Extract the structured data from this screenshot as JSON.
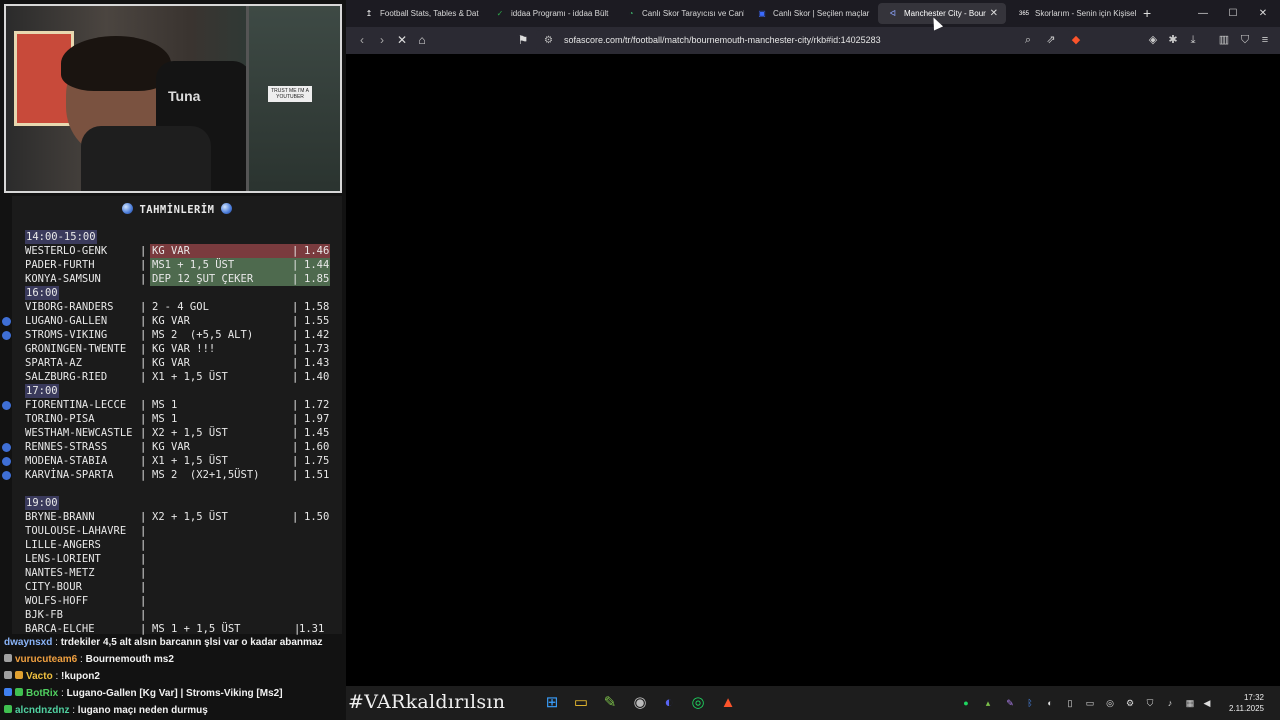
{
  "overlay": {
    "title": "TAHMİNLERİM",
    "rows": [
      {
        "type": "time",
        "label": "14:00-15:00"
      },
      {
        "type": "bet",
        "match": "WESTERLO-GENK",
        "bet": "KG VAR",
        "odds": "1.46",
        "hl": "red"
      },
      {
        "type": "bet",
        "match": "PADER-FURTH",
        "bet": "MS1 + 1,5 ÜST",
        "odds": "1.44",
        "hl": "green"
      },
      {
        "type": "bet",
        "match": "KONYA-SAMSUN",
        "bet": "DEP 12 ŞUT ÇEKER",
        "odds": "1.85",
        "hl": "green"
      },
      {
        "type": "time",
        "label": "16:00"
      },
      {
        "type": "bet",
        "match": "VIBORG-RANDERS",
        "bet": "2 - 4 GOL",
        "odds": "1.58"
      },
      {
        "type": "bet",
        "match": "LUGANO-GALLEN",
        "bet": "KG VAR",
        "odds": "1.55",
        "bullet": true
      },
      {
        "type": "bet",
        "match": "STROMS-VIKING",
        "bet": "MS 2  (+5,5 ALT)",
        "odds": "1.42",
        "bullet": true
      },
      {
        "type": "bet",
        "match": "GRONINGEN-TWENTE",
        "bet": "KG VAR !!!",
        "odds": "1.73"
      },
      {
        "type": "bet",
        "match": "SPARTA-AZ",
        "bet": "KG VAR",
        "odds": "1.43"
      },
      {
        "type": "bet",
        "match": "SALZBURG-RIED",
        "bet": "X1 + 1,5 ÜST",
        "odds": "1.40"
      },
      {
        "type": "time",
        "label": "17:00"
      },
      {
        "type": "bet",
        "match": "FIORENTINA-LECCE",
        "bet": "MS 1",
        "odds": "1.72",
        "bullet": true
      },
      {
        "type": "bet",
        "match": "TORINO-PISA",
        "bet": "MS 1",
        "odds": "1.97"
      },
      {
        "type": "bet",
        "match": "WESTHAM-NEWCASTLE",
        "bet": "X2 + 1,5 ÜST",
        "odds": "1.45"
      },
      {
        "type": "bet",
        "match": "RENNES-STRASS",
        "bet": "KG VAR",
        "odds": "1.60",
        "bullet": true
      },
      {
        "type": "bet",
        "match": "MODENA-STABIA",
        "bet": "X1 + 1,5 ÜST",
        "odds": "1.75",
        "bullet": true
      },
      {
        "type": "bet",
        "match": "KARVİNA-SPARTA",
        "bet": "MS 2  (X2+1,5ÜST)",
        "odds": "1.51",
        "bullet": true
      },
      {
        "type": "blank"
      },
      {
        "type": "time",
        "label": "19:00"
      },
      {
        "type": "bet",
        "match": "BRYNE-BRANN",
        "bet": "X2 + 1,5 ÜST",
        "odds": "1.50"
      },
      {
        "type": "bet",
        "match": "TOULOUSE-LAHAVRE",
        "bet": "",
        "odds": ""
      },
      {
        "type": "bet",
        "match": "LILLE-ANGERS",
        "bet": "",
        "odds": ""
      },
      {
        "type": "bet",
        "match": "LENS-LORIENT",
        "bet": "",
        "odds": ""
      },
      {
        "type": "bet",
        "match": "NANTES-METZ",
        "bet": "",
        "odds": ""
      },
      {
        "type": "bet",
        "match": "CITY-BOUR",
        "bet": "",
        "odds": ""
      },
      {
        "type": "bet",
        "match": "WOLFS-HOFF",
        "bet": "",
        "odds": ""
      },
      {
        "type": "bet",
        "match": "BJK-FB",
        "bet": "",
        "odds": ""
      },
      {
        "type": "bet",
        "match": "BARCA-ELCHE",
        "bet": "MS 1 + 1,5 ÜST",
        "odds": "1.31",
        "tightOdds": true
      }
    ]
  },
  "webcam": {
    "shirt_text": "Tuna",
    "poster_text": "TRUST ME I'M A YOUTUBER"
  },
  "chat": [
    {
      "user": "dwaynsxd",
      "msg": "trdekiler 4,5 alt alsın barcanın şlsi var o kadar abanmaz",
      "color": "#8ab4f8",
      "badges": []
    },
    {
      "user": "vurucuteam6",
      "msg": "Bournemouth ms2",
      "color": "#f0a040",
      "badges": [
        "#a0a0a0"
      ]
    },
    {
      "user": "Vacto",
      "msg": "!kupon2",
      "color": "#f0c040",
      "badges": [
        "#a0a0a0",
        "#e0a030"
      ]
    },
    {
      "user": "BotRix",
      "msg": "Lugano-Gallen [Kg Var] | Stroms-Viking [Ms2]",
      "color": "#50d060",
      "badges": [
        "#4080f0",
        "#40c050"
      ]
    },
    {
      "user": "alcndnzdnz",
      "msg": "lugano maçı neden durmuş",
      "color": "#50d0a0",
      "badges": [
        "#40c050"
      ]
    }
  ],
  "browser": {
    "tabs": [
      {
        "label": "Football Stats, Tables & Dat",
        "icon": "↥",
        "icon_color": "#ffffff",
        "active": false
      },
      {
        "label": "iddaa Programı - iddaa Bült",
        "icon": "✓",
        "icon_color": "#2ea84a",
        "active": false
      },
      {
        "label": "Canlı Skor Tarayıcısı ve Canlı",
        "icon": "◔",
        "icon_color": "#3fb56e",
        "active": false
      },
      {
        "label": "Canlı Skor | Seçilen maçlar",
        "icon": "▣",
        "icon_color": "#3b6bff",
        "active": false
      },
      {
        "label": "Manchester City - Bour",
        "icon": "ᐊ",
        "icon_color": "#8fa6ff",
        "active": true
      },
      {
        "label": "Skorlarım - Senin için Kişisel",
        "icon": "365",
        "icon_color": "#ffffff",
        "active": false
      }
    ],
    "new_tab_label": "+",
    "url": "sofascore.com/tr/football/match/bournemouth-manchester-city/rkb#id:14025283",
    "window_controls": [
      "—",
      "☐",
      "✕"
    ]
  },
  "taskbar": {
    "hashtag": "#VARkaldırılsın",
    "time": "17:32",
    "date": "2.11.2025",
    "apps": [
      {
        "name": "windows-start-icon",
        "glyph": "⊞",
        "color": "#3aa0ff"
      },
      {
        "name": "file-explorer-icon",
        "glyph": "▭",
        "color": "#f2c230"
      },
      {
        "name": "notepad-icon",
        "glyph": "✎",
        "color": "#7bbf4a"
      },
      {
        "name": "obs-icon",
        "glyph": "◉",
        "color": "#bbbbbb"
      },
      {
        "name": "discord-icon",
        "glyph": "◐",
        "color": "#5865f2"
      },
      {
        "name": "spotify-icon",
        "glyph": "◎",
        "color": "#1ed760"
      },
      {
        "name": "brave-icon",
        "glyph": "▲",
        "color": "#fb542b"
      }
    ]
  }
}
